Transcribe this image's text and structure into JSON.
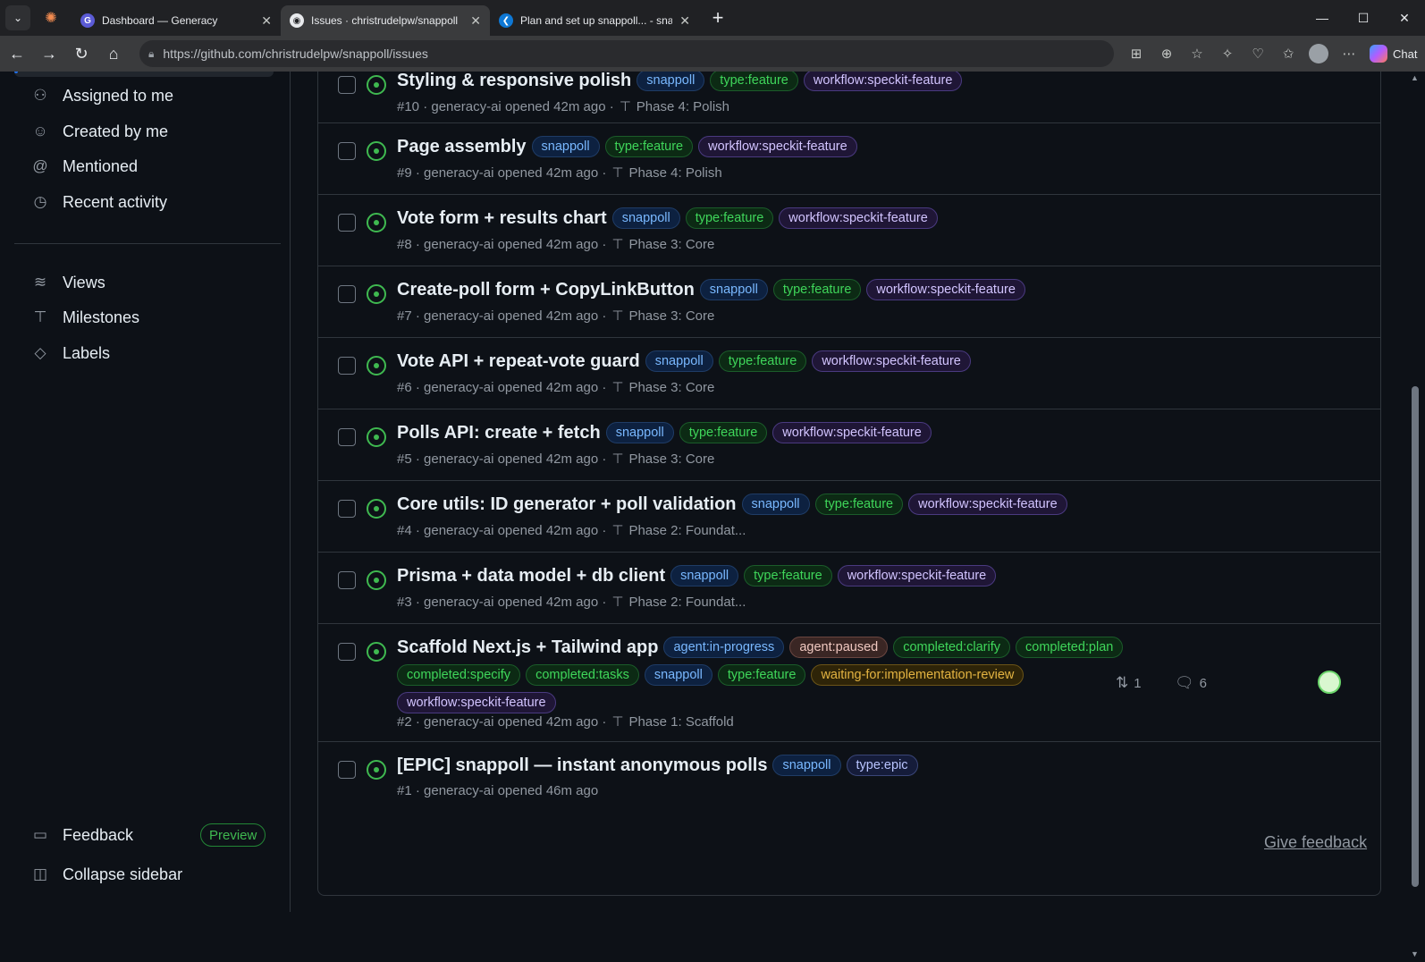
{
  "browser": {
    "tabs": [
      {
        "title": "Dashboard — Generacy",
        "fav": "G",
        "fav_bg": "#5b5bd6"
      },
      {
        "title": "Issues · christrudelpw/snappoll",
        "fav": "◉",
        "fav_bg": "#e8eaed",
        "active": true
      },
      {
        "title": "Plan and set up snappoll... - snapp",
        "fav": "❮",
        "fav_bg": "#0e78d5"
      }
    ],
    "url": "https://github.com/christrudelpw/snappoll/issues",
    "chat_label": "Chat"
  },
  "sidebar": {
    "items": [
      {
        "label": "Assigned to me",
        "icon": "people-icon"
      },
      {
        "label": "Created by me",
        "icon": "smiley-icon"
      },
      {
        "label": "Mentioned",
        "icon": "mention-icon"
      },
      {
        "label": "Recent activity",
        "icon": "clock-icon"
      },
      {
        "label": "Views",
        "icon": "stack-icon"
      },
      {
        "label": "Milestones",
        "icon": "milestone-icon"
      },
      {
        "label": "Labels",
        "icon": "tag-icon"
      }
    ],
    "feedback": "Feedback",
    "preview": "Preview",
    "collapse": "Collapse sidebar"
  },
  "issues": [
    {
      "title": "Styling & responsive polish",
      "number": "#10",
      "author": "generacy-ai",
      "opened": "opened 42m ago",
      "milestone": "Phase 4: Polish",
      "labels": [
        {
          "t": "snappoll",
          "c": "snappoll"
        },
        {
          "t": "type:feature",
          "c": "feature"
        },
        {
          "t": "workflow:speckit-feature",
          "c": "workflow"
        }
      ]
    },
    {
      "title": "Page assembly",
      "number": "#9",
      "author": "generacy-ai",
      "opened": "opened 42m ago",
      "milestone": "Phase 4: Polish",
      "labels": [
        {
          "t": "snappoll",
          "c": "snappoll"
        },
        {
          "t": "type:feature",
          "c": "feature"
        },
        {
          "t": "workflow:speckit-feature",
          "c": "workflow"
        }
      ]
    },
    {
      "title": "Vote form + results chart",
      "number": "#8",
      "author": "generacy-ai",
      "opened": "opened 42m ago",
      "milestone": "Phase 3: Core",
      "labels": [
        {
          "t": "snappoll",
          "c": "snappoll"
        },
        {
          "t": "type:feature",
          "c": "feature"
        },
        {
          "t": "workflow:speckit-feature",
          "c": "workflow"
        }
      ]
    },
    {
      "title": "Create-poll form + CopyLinkButton",
      "number": "#7",
      "author": "generacy-ai",
      "opened": "opened 42m ago",
      "milestone": "Phase 3: Core",
      "labels": [
        {
          "t": "snappoll",
          "c": "snappoll"
        },
        {
          "t": "type:feature",
          "c": "feature"
        },
        {
          "t": "workflow:speckit-feature",
          "c": "workflow"
        }
      ]
    },
    {
      "title": "Vote API + repeat-vote guard",
      "number": "#6",
      "author": "generacy-ai",
      "opened": "opened 42m ago",
      "milestone": "Phase 3: Core",
      "labels": [
        {
          "t": "snappoll",
          "c": "snappoll"
        },
        {
          "t": "type:feature",
          "c": "feature"
        },
        {
          "t": "workflow:speckit-feature",
          "c": "workflow"
        }
      ]
    },
    {
      "title": "Polls API: create + fetch",
      "number": "#5",
      "author": "generacy-ai",
      "opened": "opened 42m ago",
      "milestone": "Phase 3: Core",
      "labels": [
        {
          "t": "snappoll",
          "c": "snappoll"
        },
        {
          "t": "type:feature",
          "c": "feature"
        },
        {
          "t": "workflow:speckit-feature",
          "c": "workflow"
        }
      ]
    },
    {
      "title": "Core utils: ID generator + poll validation",
      "number": "#4",
      "author": "generacy-ai",
      "opened": "opened 42m ago",
      "milestone": "Phase 2: Foundat...",
      "labels": [
        {
          "t": "snappoll",
          "c": "snappoll"
        },
        {
          "t": "type:feature",
          "c": "feature"
        },
        {
          "t": "workflow:speckit-feature",
          "c": "workflow"
        }
      ]
    },
    {
      "title": "Prisma + data model + db client",
      "number": "#3",
      "author": "generacy-ai",
      "opened": "opened 42m ago",
      "milestone": "Phase 2: Foundat...",
      "labels": [
        {
          "t": "snappoll",
          "c": "snappoll"
        },
        {
          "t": "type:feature",
          "c": "feature"
        },
        {
          "t": "workflow:speckit-feature",
          "c": "workflow"
        }
      ]
    },
    {
      "title": "Scaffold Next.js + Tailwind app",
      "number": "#2",
      "author": "generacy-ai",
      "opened": "opened 42m ago",
      "milestone": "Phase 1: Scaffold",
      "prs": "1",
      "comments": "6",
      "labels": [
        {
          "t": "agent:in-progress",
          "c": "inprog"
        },
        {
          "t": "agent:paused",
          "c": "paused"
        },
        {
          "t": "completed:clarify",
          "c": "completed"
        },
        {
          "t": "completed:plan",
          "c": "completed"
        },
        {
          "t": "completed:specify",
          "c": "completed"
        },
        {
          "t": "completed:tasks",
          "c": "completed"
        },
        {
          "t": "snappoll",
          "c": "snappoll"
        },
        {
          "t": "type:feature",
          "c": "feature"
        },
        {
          "t": "waiting-for:implementation-review",
          "c": "waiting"
        },
        {
          "t": "workflow:speckit-feature",
          "c": "workflow"
        }
      ]
    },
    {
      "title": "[EPIC] snappoll — instant anonymous polls",
      "number": "#1",
      "author": "generacy-ai",
      "opened": "opened 46m ago",
      "milestone": "",
      "labels": [
        {
          "t": "snappoll",
          "c": "snappoll"
        },
        {
          "t": "type:epic",
          "c": "epic"
        }
      ]
    }
  ],
  "give_feedback": "Give feedback"
}
